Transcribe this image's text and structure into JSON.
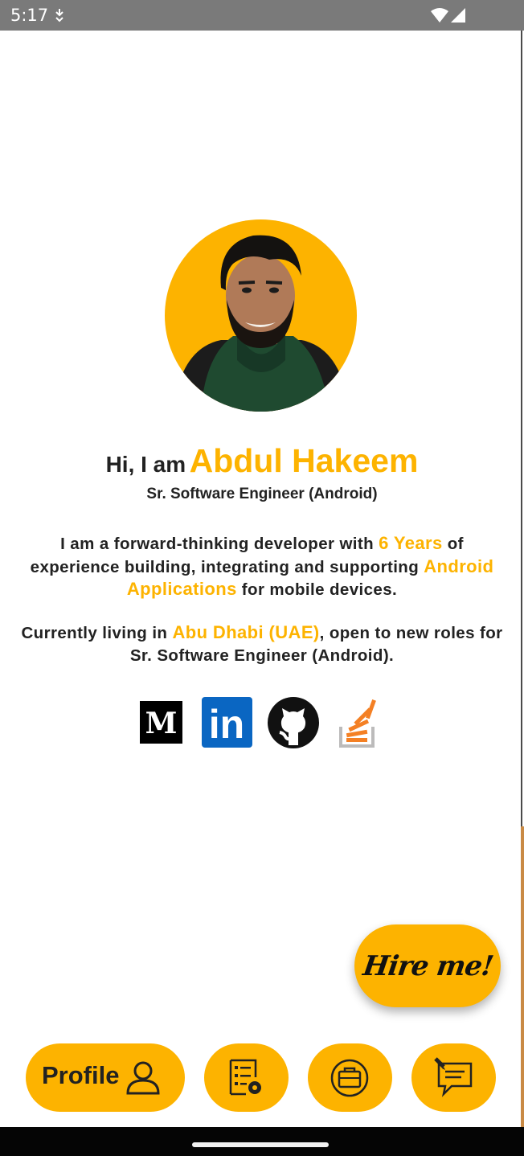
{
  "status_bar": {
    "time": "5:17",
    "icons": [
      "download-icon",
      "wifi-icon",
      "signal-icon"
    ]
  },
  "profile": {
    "greeting": "Hi, I am",
    "name": "Abdul Hakeem",
    "title": "Sr. Software Engineer (Android)",
    "intro": {
      "part1": "I am a forward-thinking developer with ",
      "years": "6 Years",
      "part2": " of experience building, integrating and supporting ",
      "apps": "Android Applications",
      "part3": " for mobile devices."
    },
    "location": {
      "part1": "Currently living in ",
      "place": "Abu Dhabi (UAE)",
      "part2": ", open to new roles for Sr. Software Engineer (Android)."
    }
  },
  "socials": {
    "medium_letter": "M",
    "linkedin_text": "in",
    "icons": [
      "medium-icon",
      "linkedin-icon",
      "github-icon",
      "stackoverflow-icon"
    ]
  },
  "fab": {
    "label": "Hire me!"
  },
  "nav": {
    "profile_label": "Profile",
    "icons": [
      "user-icon",
      "skills-icon",
      "briefcase-icon",
      "contact-icon"
    ]
  },
  "colors": {
    "accent": "#FDB300",
    "text": "#222222",
    "status_bar": "#7a7a7a",
    "linkedin": "#0a66c2",
    "stackoverflow": "#f48024"
  }
}
